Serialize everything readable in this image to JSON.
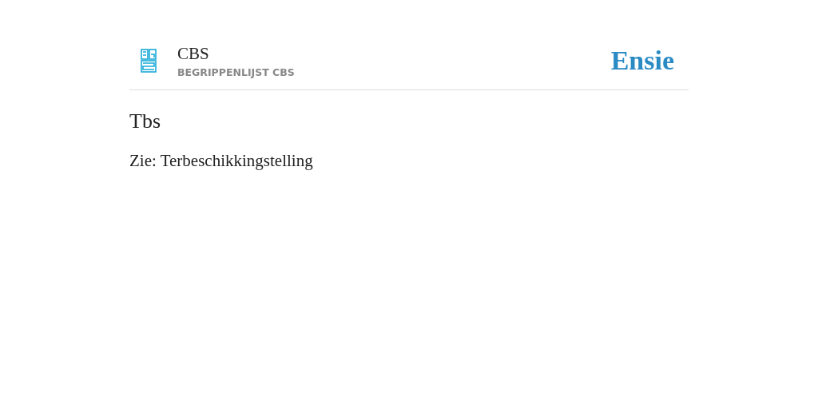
{
  "header": {
    "title": "CBS",
    "subtitle": "BEGRIPPENLIJST CBS",
    "brand": "Ensie"
  },
  "entry": {
    "term": "Tbs",
    "definition": "Zie: Terbeschikkingstelling"
  }
}
